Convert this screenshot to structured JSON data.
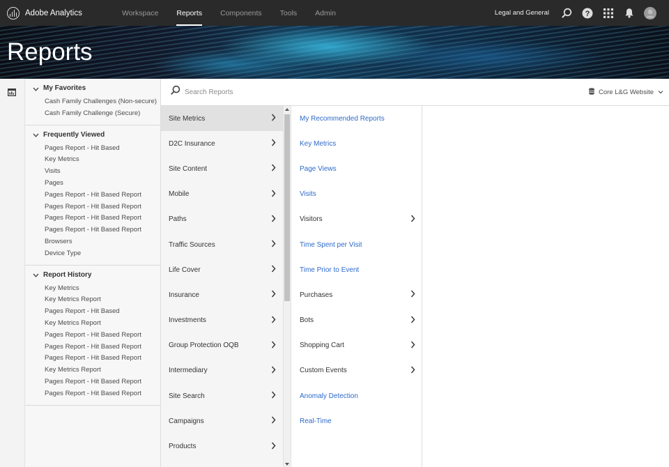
{
  "topnav": {
    "brand": "Adobe Analytics",
    "tabs": [
      {
        "label": "Workspace",
        "active": false
      },
      {
        "label": "Reports",
        "active": true
      },
      {
        "label": "Components",
        "active": false
      },
      {
        "label": "Tools",
        "active": false
      },
      {
        "label": "Admin",
        "active": false
      }
    ],
    "company": "Legal and General",
    "icons": [
      "search-icon",
      "help-icon",
      "apps-grid-icon",
      "bell-icon",
      "avatar"
    ]
  },
  "banner": {
    "title": "Reports"
  },
  "sidebar": {
    "sections": [
      {
        "title": "My Favorites",
        "items": [
          "Cash Family Challenges (Non-secure)",
          "Cash Family Challenge (Secure)"
        ]
      },
      {
        "title": "Frequently Viewed",
        "items": [
          "Pages Report - Hit Based",
          "Key Metrics",
          "Visits",
          "Pages",
          "Pages Report - Hit Based Report",
          "Pages Report - Hit Based Report",
          "Pages Report - Hit Based Report",
          "Pages Report - Hit Based Report",
          "Browsers",
          "Device Type"
        ]
      },
      {
        "title": "Report History",
        "items": [
          "Key Metrics",
          "Key Metrics Report",
          "Pages Report - Hit Based",
          "Key Metrics Report",
          "Pages Report - Hit Based Report",
          "Pages Report - Hit Based Report",
          "Pages Report - Hit Based Report",
          "Key Metrics Report",
          "Pages Report - Hit Based Report",
          "Pages Report - Hit Based Report"
        ]
      }
    ]
  },
  "search": {
    "placeholder": "Search Reports"
  },
  "report_suite": {
    "label": "Core L&G Website"
  },
  "categories": [
    {
      "label": "Site Metrics",
      "active": true
    },
    {
      "label": "D2C Insurance",
      "active": false
    },
    {
      "label": "Site Content",
      "active": false
    },
    {
      "label": "Mobile",
      "active": false
    },
    {
      "label": "Paths",
      "active": false
    },
    {
      "label": "Traffic Sources",
      "active": false
    },
    {
      "label": "Life Cover",
      "active": false
    },
    {
      "label": "Insurance",
      "active": false
    },
    {
      "label": "Investments",
      "active": false
    },
    {
      "label": "Group Protection OQB",
      "active": false
    },
    {
      "label": "Intermediary",
      "active": false
    },
    {
      "label": "Site Search",
      "active": false
    },
    {
      "label": "Campaigns",
      "active": false
    },
    {
      "label": "Products",
      "active": false
    }
  ],
  "reports": [
    {
      "label": "My Recommended Reports",
      "submenu": false
    },
    {
      "label": "Key Metrics",
      "submenu": false
    },
    {
      "label": "Page Views",
      "submenu": false
    },
    {
      "label": "Visits",
      "submenu": false
    },
    {
      "label": "Visitors",
      "submenu": true
    },
    {
      "label": "Time Spent per Visit",
      "submenu": false
    },
    {
      "label": "Time Prior to Event",
      "submenu": false
    },
    {
      "label": "Purchases",
      "submenu": true
    },
    {
      "label": "Bots",
      "submenu": true
    },
    {
      "label": "Shopping Cart",
      "submenu": true
    },
    {
      "label": "Custom Events",
      "submenu": true
    },
    {
      "label": "Anomaly Detection",
      "submenu": false
    },
    {
      "label": "Real-Time",
      "submenu": false
    }
  ],
  "colors": {
    "nav_bg": "#2a2a2a",
    "link": "#2d6ac9",
    "active_row": "#e1e1e1"
  }
}
